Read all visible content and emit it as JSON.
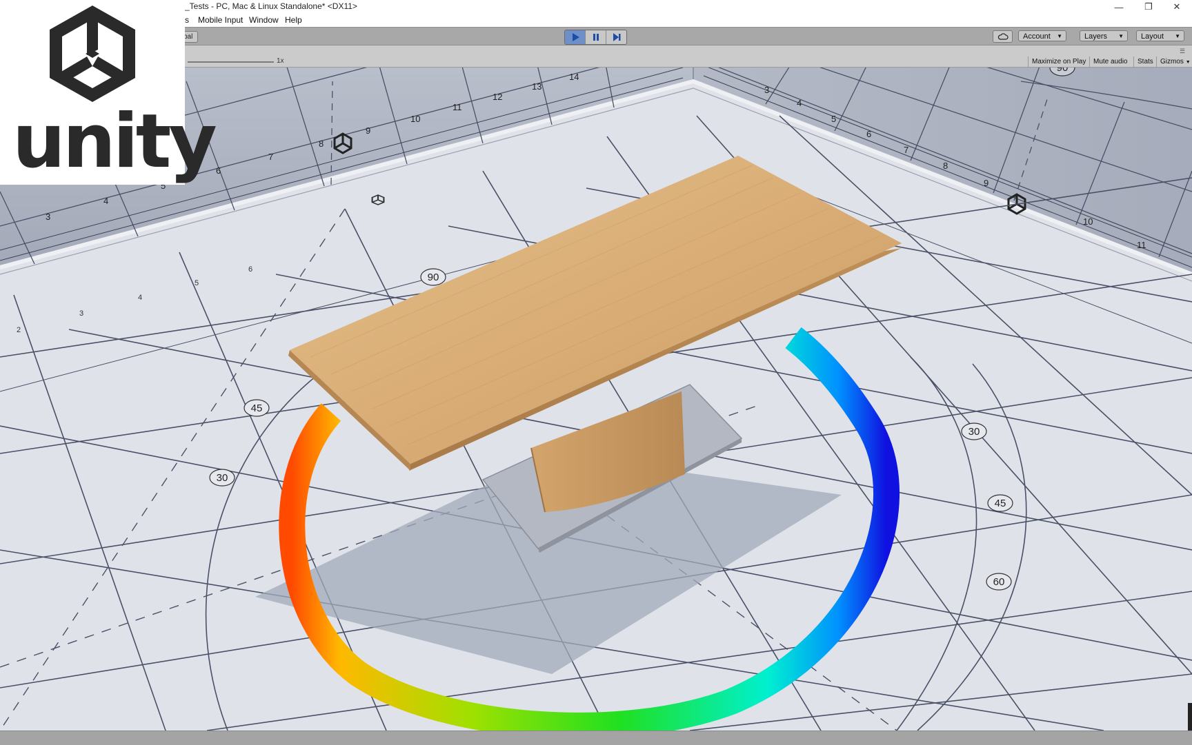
{
  "window": {
    "title": "_Tests - PC, Mac & Linux Standalone* <DX11>",
    "controls": [
      "minimize",
      "restore",
      "close"
    ]
  },
  "menu": {
    "items": [
      "s",
      "Mobile Input",
      "Window",
      "Help"
    ]
  },
  "toolbar": {
    "pivot_label": "bal",
    "play_buttons": [
      "play",
      "pause",
      "step"
    ],
    "account_label": "Account",
    "layers_label": "Layers",
    "layout_label": "Layout"
  },
  "gameview": {
    "scale_label": "1x",
    "maximize_label": "Maximize on Play",
    "mute_label": "Mute audio",
    "stats_label": "Stats",
    "gizmos_label": "Gizmos"
  },
  "scene": {
    "ruler_left_numbers": [
      "3",
      "4",
      "5",
      "6",
      "7",
      "8",
      "9",
      "10",
      "11",
      "12",
      "13",
      "14"
    ],
    "ruler_right_numbers": [
      "3",
      "4",
      "5",
      "6",
      "7",
      "8",
      "9",
      "10",
      "11"
    ],
    "floor_left_numbers": [
      "2",
      "3",
      "4",
      "5",
      "6"
    ],
    "angle_labels": [
      "90",
      "45",
      "30",
      "30",
      "45",
      "60",
      "90"
    ]
  },
  "logo": {
    "word": "unity"
  },
  "colors": {
    "toolbar": "#a8a8a8",
    "play_active": "#6e8fc7",
    "wood": "#ddb37d",
    "grid_line": "#4a5066"
  }
}
